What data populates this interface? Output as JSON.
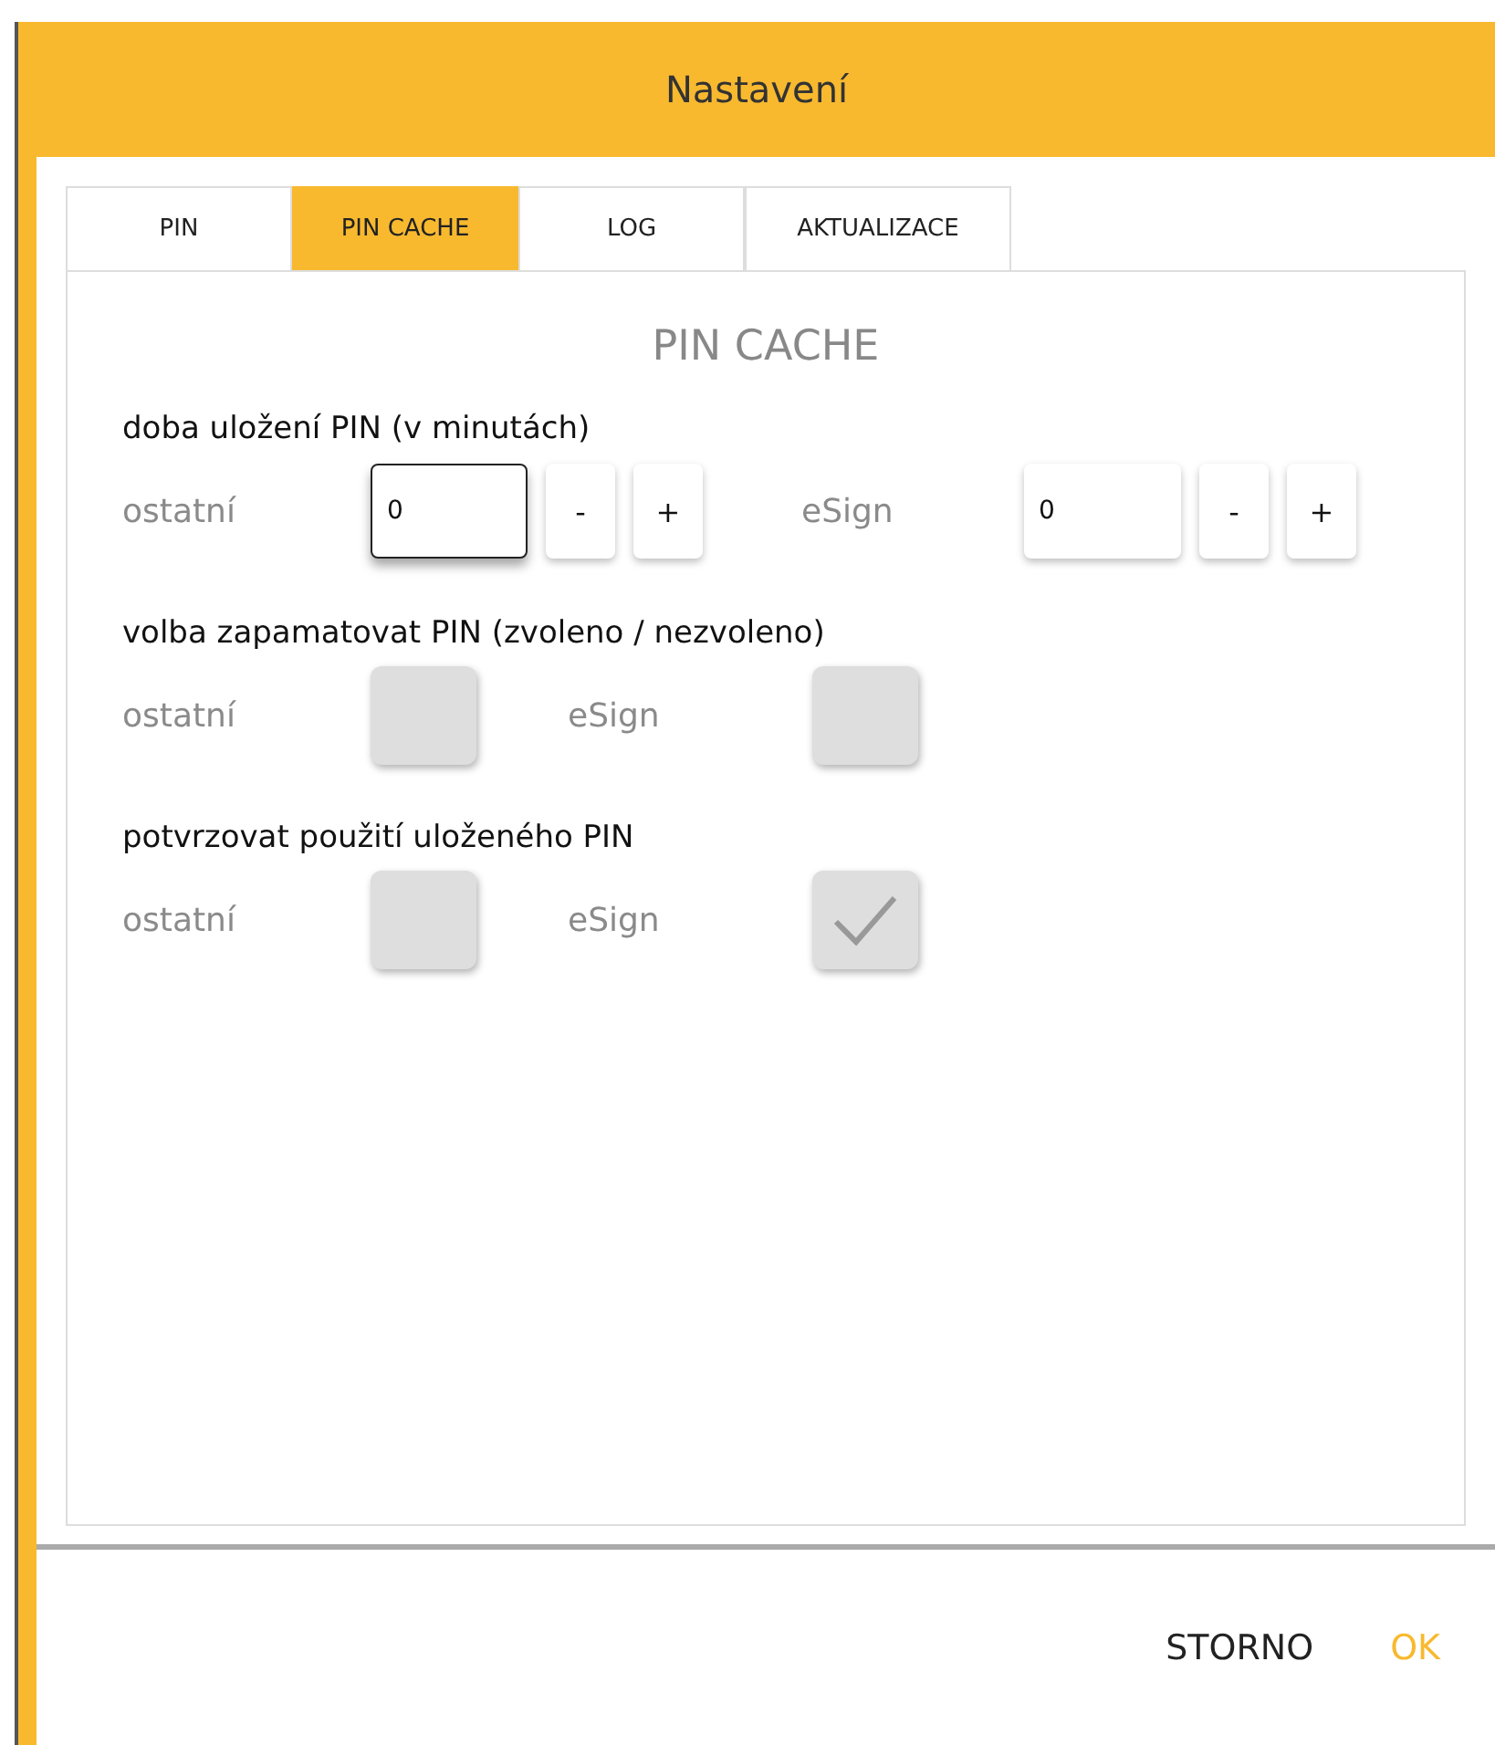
{
  "window": {
    "title": "Nastavení"
  },
  "tabs": [
    {
      "label": "PIN",
      "selected": false
    },
    {
      "label": "PIN CACHE",
      "selected": true
    },
    {
      "label": "LOG",
      "selected": false
    },
    {
      "label": "AKTUALIZACE",
      "selected": false
    }
  ],
  "panel": {
    "heading": "PIN CACHE",
    "sections": [
      {
        "title": "doba uložení PIN (v minutách)",
        "kind": "stepper",
        "items": [
          {
            "label": "ostatní",
            "value": "0",
            "focused": true,
            "minus": "-",
            "plus": "+"
          },
          {
            "label": "eSign",
            "value": "0",
            "focused": false,
            "minus": "-",
            "plus": "+"
          }
        ]
      },
      {
        "title": "volba zapamatovat PIN (zvoleno / nezvoleno)",
        "kind": "checkbox",
        "items": [
          {
            "label": "ostatní",
            "checked": false
          },
          {
            "label": "eSign",
            "checked": false
          }
        ]
      },
      {
        "title": "potvrzovat použití uloženého PIN",
        "kind": "checkbox",
        "items": [
          {
            "label": "ostatní",
            "checked": false
          },
          {
            "label": "eSign",
            "checked": true
          }
        ]
      }
    ]
  },
  "buttons": [
    {
      "label": "STORNO",
      "primary": false
    },
    {
      "label": "OK",
      "primary": true
    }
  ]
}
